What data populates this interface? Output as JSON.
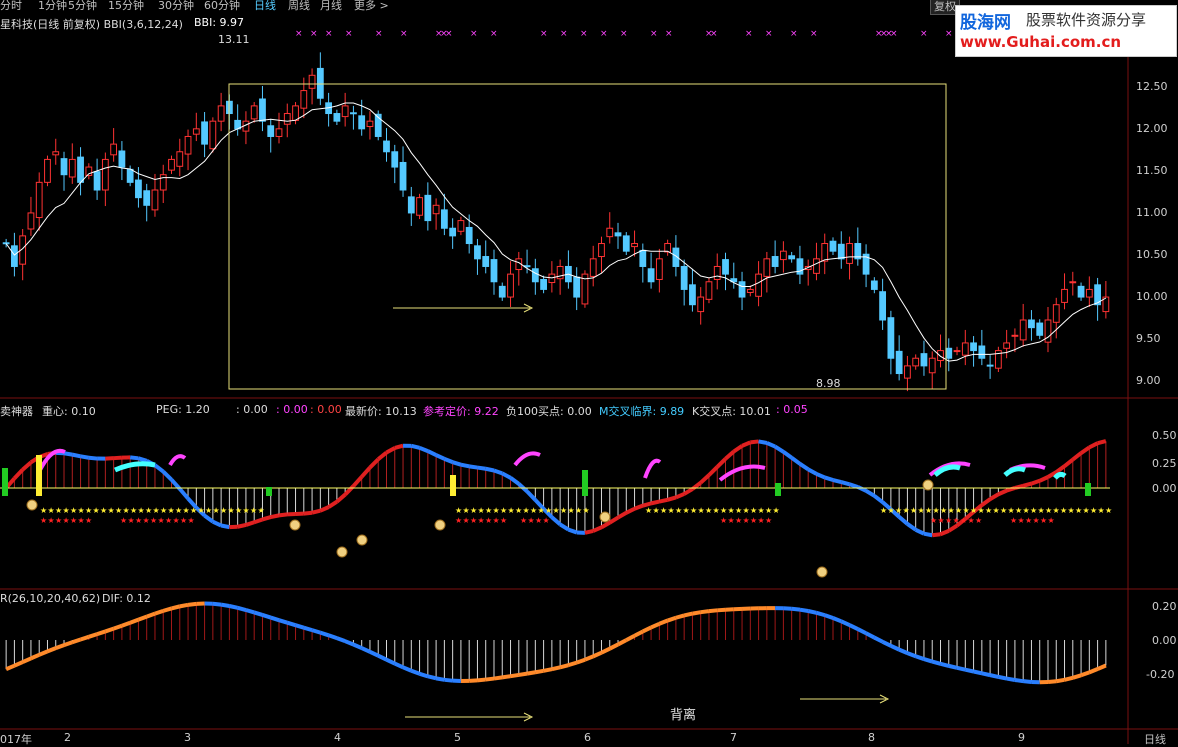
{
  "toolbar": {
    "periods": [
      {
        "label": "分时",
        "active": false
      },
      {
        "label": "1分钟",
        "active": false
      },
      {
        "label": "5分钟",
        "active": false
      },
      {
        "label": "15分钟",
        "active": false
      },
      {
        "label": "30分钟",
        "active": false
      },
      {
        "label": "60分钟",
        "active": false
      },
      {
        "label": "日线",
        "active": true
      },
      {
        "label": "周线",
        "active": false
      },
      {
        "label": "月线",
        "active": false
      },
      {
        "label": "更多 >",
        "active": false
      }
    ],
    "restore_label": "复权"
  },
  "watermark": {
    "site": "股海网",
    "slogan": "股票软件资源分享",
    "url": "www.Guhai.com.cn"
  },
  "main_panel": {
    "title": "星科技(日线 前复权) BBI(3,6,12,24)",
    "bbi_label": "BBI: 9.97",
    "high_marker": "13.11",
    "low_marker": "8.98",
    "y_ticks": [
      "12.50",
      "12.00",
      "11.50",
      "11.00",
      "10.50",
      "10.00",
      "9.50",
      "9.00"
    ]
  },
  "indicator_panel": {
    "name": "卖神器",
    "center_label": "重心: 0.10",
    "peg_label": "PEG: 1.20",
    "v1": ": 0.00",
    "v2": ": 0.00",
    "v3": ": 0.00",
    "latest_price": "最新价: 10.13",
    "ref_price": "参考定价: 9.22",
    "neg100": "负100买点: 0.00",
    "m_cross": "M交叉临界: 9.89",
    "k_cross": "K交叉点: 10.01",
    "v4": ": 0.05",
    "y_ticks": [
      "0.50",
      "0.25",
      "0.00"
    ]
  },
  "macd_panel": {
    "title": "R(26,10,20,40,62)",
    "dif": "DIF: 0.12",
    "annotation": "背离",
    "y_ticks": [
      "0.20",
      "0.00",
      "-0.20"
    ]
  },
  "x_axis": {
    "labels": [
      "017年",
      "2",
      "3",
      "4",
      "5",
      "6",
      "7",
      "8",
      "9"
    ],
    "period_label": "日线"
  },
  "colors": {
    "up": "#ff3333",
    "down": "#54c9ff",
    "bbi": "#ffffff",
    "box": "#e8e07a",
    "star_yellow": "#ffee33",
    "star_red": "#ff2222",
    "magenta": "#ff44ff",
    "cyan": "#44ffff",
    "macd_blue": "#2a7fff",
    "macd_orange": "#ff8a2a"
  },
  "chart_data": {
    "type": "candlestick",
    "ylim": [
      8.95,
      13.2
    ],
    "closes": [
      10.8,
      10.5,
      10.9,
      11.2,
      11.6,
      11.9,
      12.0,
      11.7,
      11.9,
      11.6,
      11.8,
      11.5,
      11.9,
      12.1,
      11.8,
      11.6,
      11.4,
      11.3,
      11.5,
      11.7,
      11.9,
      12.0,
      12.2,
      12.3,
      12.1,
      12.4,
      12.6,
      12.5,
      12.3,
      12.4,
      12.6,
      12.4,
      12.2,
      12.3,
      12.5,
      12.6,
      12.8,
      13.0,
      12.7,
      12.5,
      12.4,
      12.6,
      12.5,
      12.3,
      12.4,
      12.2,
      12.0,
      11.8,
      11.5,
      11.2,
      11.4,
      11.1,
      11.3,
      11.0,
      10.9,
      11.1,
      10.8,
      10.6,
      10.5,
      10.3,
      10.1,
      10.4,
      10.6,
      10.5,
      10.3,
      10.2,
      10.4,
      10.5,
      10.3,
      10.1,
      10.4,
      10.6,
      10.8,
      11.0,
      10.9,
      10.7,
      10.8,
      10.5,
      10.3,
      10.6,
      10.8,
      10.5,
      10.2,
      10.0,
      10.1,
      10.3,
      10.5,
      10.4,
      10.3,
      10.1,
      10.2,
      10.4,
      10.6,
      10.5,
      10.7,
      10.6,
      10.4,
      10.5,
      10.6,
      10.8,
      10.7,
      10.6,
      10.8,
      10.6,
      10.4,
      10.2,
      9.8,
      9.3,
      9.1,
      9.2,
      9.3,
      9.2,
      9.3,
      9.4,
      9.3,
      9.4,
      9.5,
      9.4,
      9.3,
      9.2,
      9.4,
      9.5,
      9.6,
      9.8,
      9.7,
      9.6,
      9.8,
      10.0,
      10.2,
      10.3,
      10.1,
      10.2,
      10.0,
      10.1
    ]
  }
}
